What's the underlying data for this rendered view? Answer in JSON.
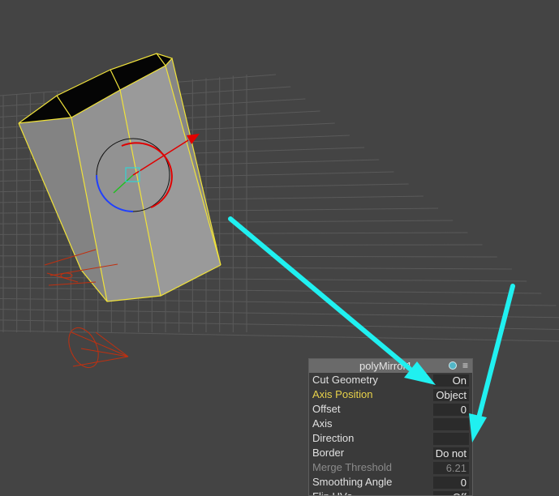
{
  "colors": {
    "background": "#444444",
    "grid": "#5a5a5a",
    "selection_outline": "#f0e23a",
    "mesh_face": "#8e8e8e",
    "annotation_arrow": "#20f0f0",
    "camera_wire": "#c03010",
    "axis_x": "#e00000",
    "axis_y": "#20c020",
    "axis_z": "#2040ff",
    "label_highlight": "#e8d24a"
  },
  "panel": {
    "title": "polyMirror1",
    "icons": [
      "cycle-icon",
      "menu-icon"
    ],
    "rows": [
      {
        "label": "Cut Geometry",
        "value": "On",
        "state": "normal"
      },
      {
        "label": "Axis Position",
        "value": "Object",
        "state": "highlight"
      },
      {
        "label": "Offset",
        "value": "0",
        "state": "normal"
      },
      {
        "label": "Axis",
        "value": "",
        "state": "normal"
      },
      {
        "label": "Direction",
        "value": "",
        "state": "normal"
      },
      {
        "label": "Border",
        "value": "Do not",
        "state": "normal"
      },
      {
        "label": "Merge Threshold",
        "value": "6.21",
        "state": "disabled"
      },
      {
        "label": "Smoothing Angle",
        "value": "0",
        "state": "normal"
      },
      {
        "label": "Flip UVs",
        "value": "Off",
        "state": "normal"
      }
    ]
  }
}
